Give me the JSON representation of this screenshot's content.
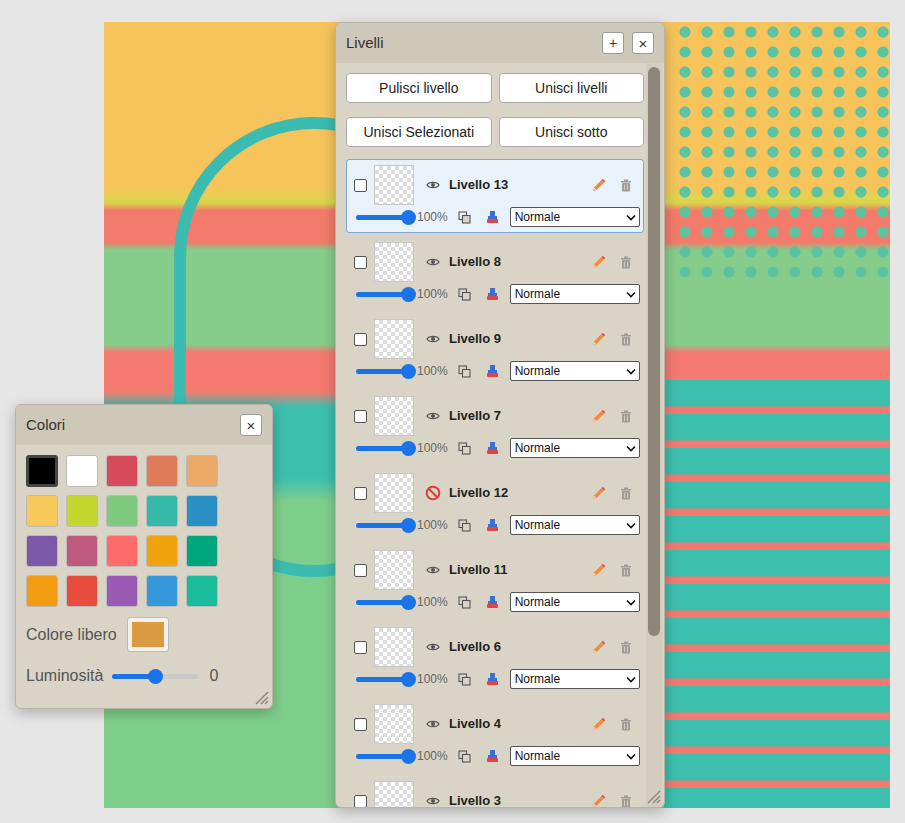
{
  "layers_panel": {
    "title": "Livelli",
    "add_button": "+",
    "close_button": "×",
    "actions": [
      "Pulisci livello",
      "Unisci livelli",
      "Unisci Selezionati",
      "Unisci sotto"
    ],
    "layers": [
      {
        "name": "Livello 13",
        "checked": false,
        "selected": true,
        "visible": true,
        "opacity": {
          "level": 1,
          "reading": "100%"
        },
        "blend_mode": "Normale"
      },
      {
        "name": "Livello 8",
        "checked": false,
        "selected": false,
        "visible": true,
        "opacity": {
          "level": 1,
          "reading": "100%"
        },
        "blend_mode": "Normale"
      },
      {
        "name": "Livello 9",
        "checked": false,
        "selected": false,
        "visible": true,
        "opacity": {
          "level": 1,
          "reading": "100%"
        },
        "blend_mode": "Normale"
      },
      {
        "name": "Livello 7",
        "checked": false,
        "selected": false,
        "visible": true,
        "opacity": {
          "level": 1,
          "reading": "100%"
        },
        "blend_mode": "Normale"
      },
      {
        "name": "Livello 12",
        "checked": false,
        "selected": false,
        "visible": false,
        "opacity": {
          "level": 1,
          "reading": "100%"
        },
        "blend_mode": "Normale"
      },
      {
        "name": "Livello 11",
        "checked": false,
        "selected": false,
        "visible": true,
        "opacity": {
          "level": 1,
          "reading": "100%"
        },
        "blend_mode": "Normale"
      },
      {
        "name": "Livello 6",
        "checked": false,
        "selected": false,
        "visible": true,
        "opacity": {
          "level": 1,
          "reading": "100%"
        },
        "blend_mode": "Normale"
      },
      {
        "name": "Livello 4",
        "checked": false,
        "selected": false,
        "visible": true,
        "opacity": {
          "level": 1,
          "reading": "100%"
        },
        "blend_mode": "Normale"
      },
      {
        "name": "Livello 3",
        "checked": false,
        "selected": false,
        "visible": true
      }
    ]
  },
  "colors_panel": {
    "title": "Colori",
    "close_button": "×",
    "swatches": [
      {
        "color": "#000000",
        "selected": true
      },
      {
        "color": "#ffffff",
        "selected": false
      },
      {
        "color": "#d64a5c",
        "selected": false
      },
      {
        "color": "#e07b5a",
        "selected": false
      },
      {
        "color": "#ebaa6a",
        "selected": false
      },
      {
        "color": "#f7c95a",
        "selected": false
      },
      {
        "color": "#c1d82f",
        "selected": false
      },
      {
        "color": "#7fc97f",
        "selected": false
      },
      {
        "color": "#35b8a7",
        "selected": false
      },
      {
        "color": "#2a8fc4",
        "selected": false
      },
      {
        "color": "#7b59a8",
        "selected": false
      },
      {
        "color": "#be5a7e",
        "selected": false
      },
      {
        "color": "#ff6b6b",
        "selected": false
      },
      {
        "color": "#f0a30a",
        "selected": false
      },
      {
        "color": "#00a67e",
        "selected": false
      },
      {
        "color": "#f39c12",
        "selected": false
      },
      {
        "color": "#e74c3c",
        "selected": false
      },
      {
        "color": "#9b59b6",
        "selected": false
      },
      {
        "color": "#3498db",
        "selected": false
      },
      {
        "color": "#1abc9c",
        "selected": false
      }
    ],
    "free_color": {
      "label": "Colore libero",
      "color": "#d99a41"
    },
    "brightness": {
      "label": "Luminosità",
      "level": 0.5,
      "reading": "0"
    }
  }
}
